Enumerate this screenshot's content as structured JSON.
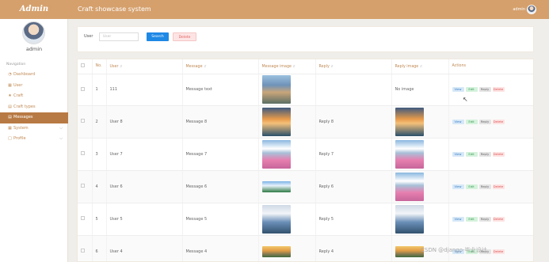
{
  "app": {
    "logo": "Admin",
    "user_name": "admin",
    "nav_title": "Navigation",
    "nav": [
      {
        "label": "Dashboard",
        "icon": "speedometer-icon",
        "has_children": false,
        "active": false
      },
      {
        "label": "User",
        "icon": "grid-icon",
        "has_children": false,
        "active": false
      },
      {
        "label": "Craft",
        "icon": "star-icon",
        "has_children": false,
        "active": false
      },
      {
        "label": "Craft types",
        "icon": "document-icon",
        "has_children": false,
        "active": false
      },
      {
        "label": "Messages",
        "icon": "document-icon",
        "has_children": false,
        "active": true
      },
      {
        "label": "System",
        "icon": "grid-icon",
        "has_children": true,
        "active": false
      },
      {
        "label": "Profile",
        "icon": "calendar-icon",
        "has_children": true,
        "active": false
      }
    ]
  },
  "header": {
    "title": "Craft showcase system",
    "user": "admin"
  },
  "search": {
    "label": "User",
    "placeholder": "User",
    "search_button": "Search",
    "delete_button": "Delete"
  },
  "table": {
    "columns": [
      "No.",
      "User",
      "Message",
      "Message image",
      "Reply",
      "Reply image",
      "Actions"
    ],
    "actions": [
      "View",
      "Edit",
      "Reply",
      "Delete"
    ],
    "rows": [
      {
        "index": "1",
        "user": "111",
        "message": "Message text",
        "msg_img": "img-a",
        "reply": "",
        "reply_img": "",
        "reply_img_text": "No image"
      },
      {
        "index": "2",
        "user": "User 8",
        "message": "Message 8",
        "msg_img": "img-b",
        "reply": "Reply 8",
        "reply_img": "img-b",
        "reply_img_text": ""
      },
      {
        "index": "3",
        "user": "User 7",
        "message": "Message 7",
        "msg_img": "img-c",
        "reply": "Reply 7",
        "reply_img": "img-c",
        "reply_img_text": ""
      },
      {
        "index": "4",
        "user": "User 6",
        "message": "Message 6",
        "msg_img": "img-e",
        "reply": "Reply 6",
        "reply_img": "img-c",
        "reply_img_text": ""
      },
      {
        "index": "5",
        "user": "User 5",
        "message": "Message 5",
        "msg_img": "img-d",
        "reply": "Reply 5",
        "reply_img": "img-d",
        "reply_img_text": ""
      },
      {
        "index": "6",
        "user": "User 4",
        "message": "Message 4",
        "msg_img": "img-f",
        "reply": "Reply 4",
        "reply_img": "img-f",
        "reply_img_text": ""
      }
    ]
  },
  "watermark": "CSDN @django-毕业设计",
  "colors": {
    "accent": "#d5a06c",
    "active_nav": "#b87a44",
    "primary_button": "#1e88e5"
  }
}
